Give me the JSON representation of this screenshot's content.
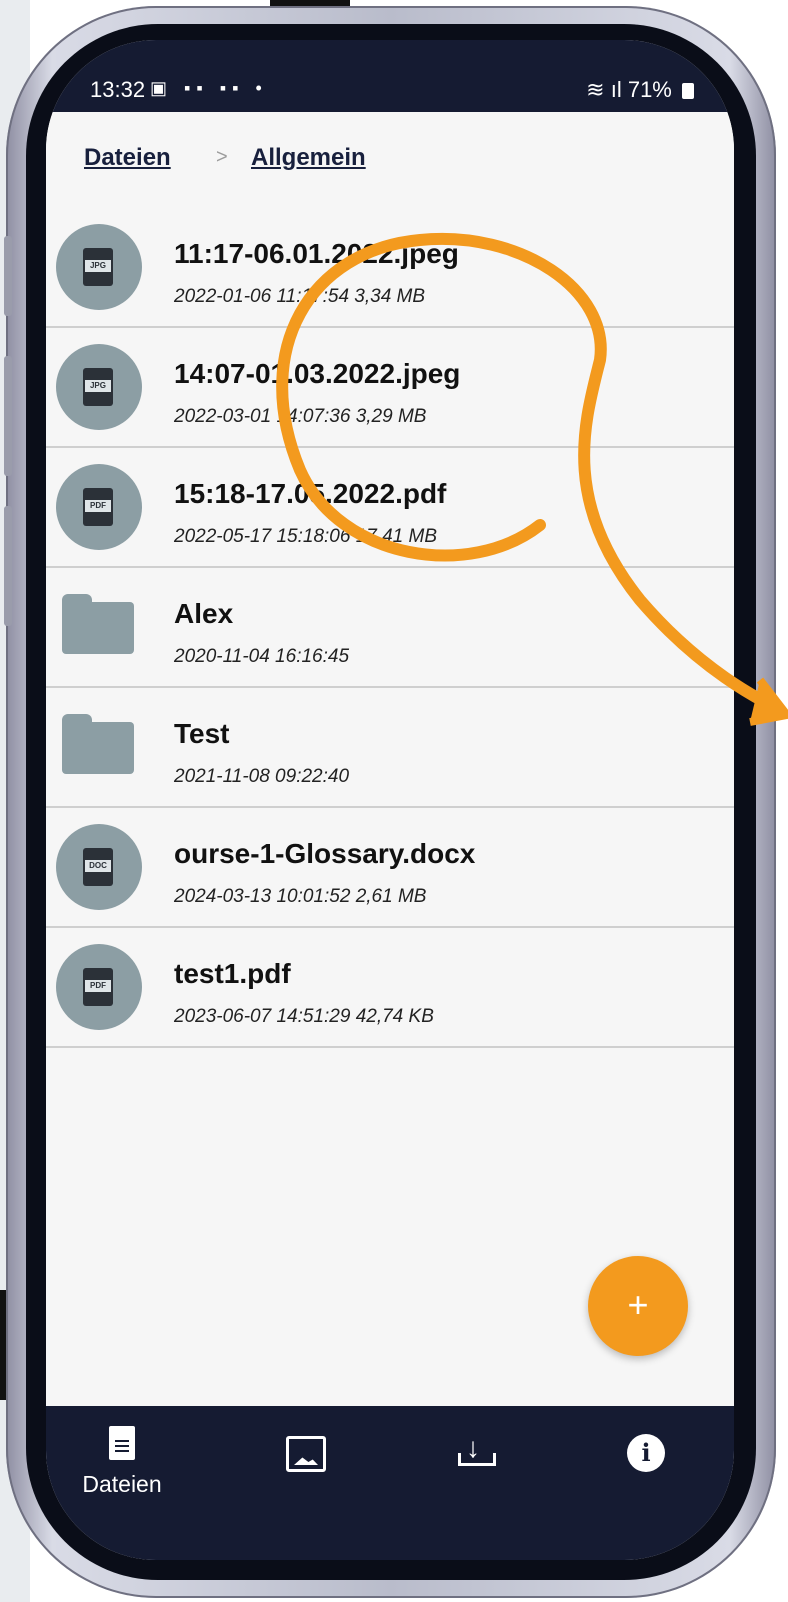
{
  "status": {
    "time": "13:32",
    "left_icons": "▣ ▪▪ ▪▪ •",
    "right": "71%"
  },
  "breadcrumb": {
    "root": "Dateien",
    "separator": ">",
    "current": "Allgemein"
  },
  "files": [
    {
      "name": "11:17-06.01.2022.jpeg",
      "meta": "2022-01-06 11:17:54  3,34 MB",
      "type": "JPG"
    },
    {
      "name": "14:07-01.03.2022.jpeg",
      "meta": "2022-03-01 14:07:36  3,29 MB",
      "type": "JPG"
    },
    {
      "name": "15:18-17.05.2022.pdf",
      "meta": "2022-05-17 15:18:06  17,41 MB",
      "type": "PDF"
    },
    {
      "name": "Alex",
      "meta": "2020-11-04 16:16:45",
      "type": "folder"
    },
    {
      "name": "Test",
      "meta": "2021-11-08 09:22:40",
      "type": "folder"
    },
    {
      "name": "ourse-1-Glossary.docx",
      "meta": "2024-03-13 10:01:52  2,61 MB",
      "type": "DOC"
    },
    {
      "name": "test1.pdf",
      "meta": "2023-06-07 14:51:29  42,74 KB",
      "type": "PDF"
    }
  ],
  "fab": {
    "label": "+"
  },
  "nav": {
    "files_label": "Dateien",
    "info_glyph": "i"
  },
  "colors": {
    "header": "#151b32",
    "accent": "#f39a1e",
    "icon_bg": "#8c9ea4"
  }
}
